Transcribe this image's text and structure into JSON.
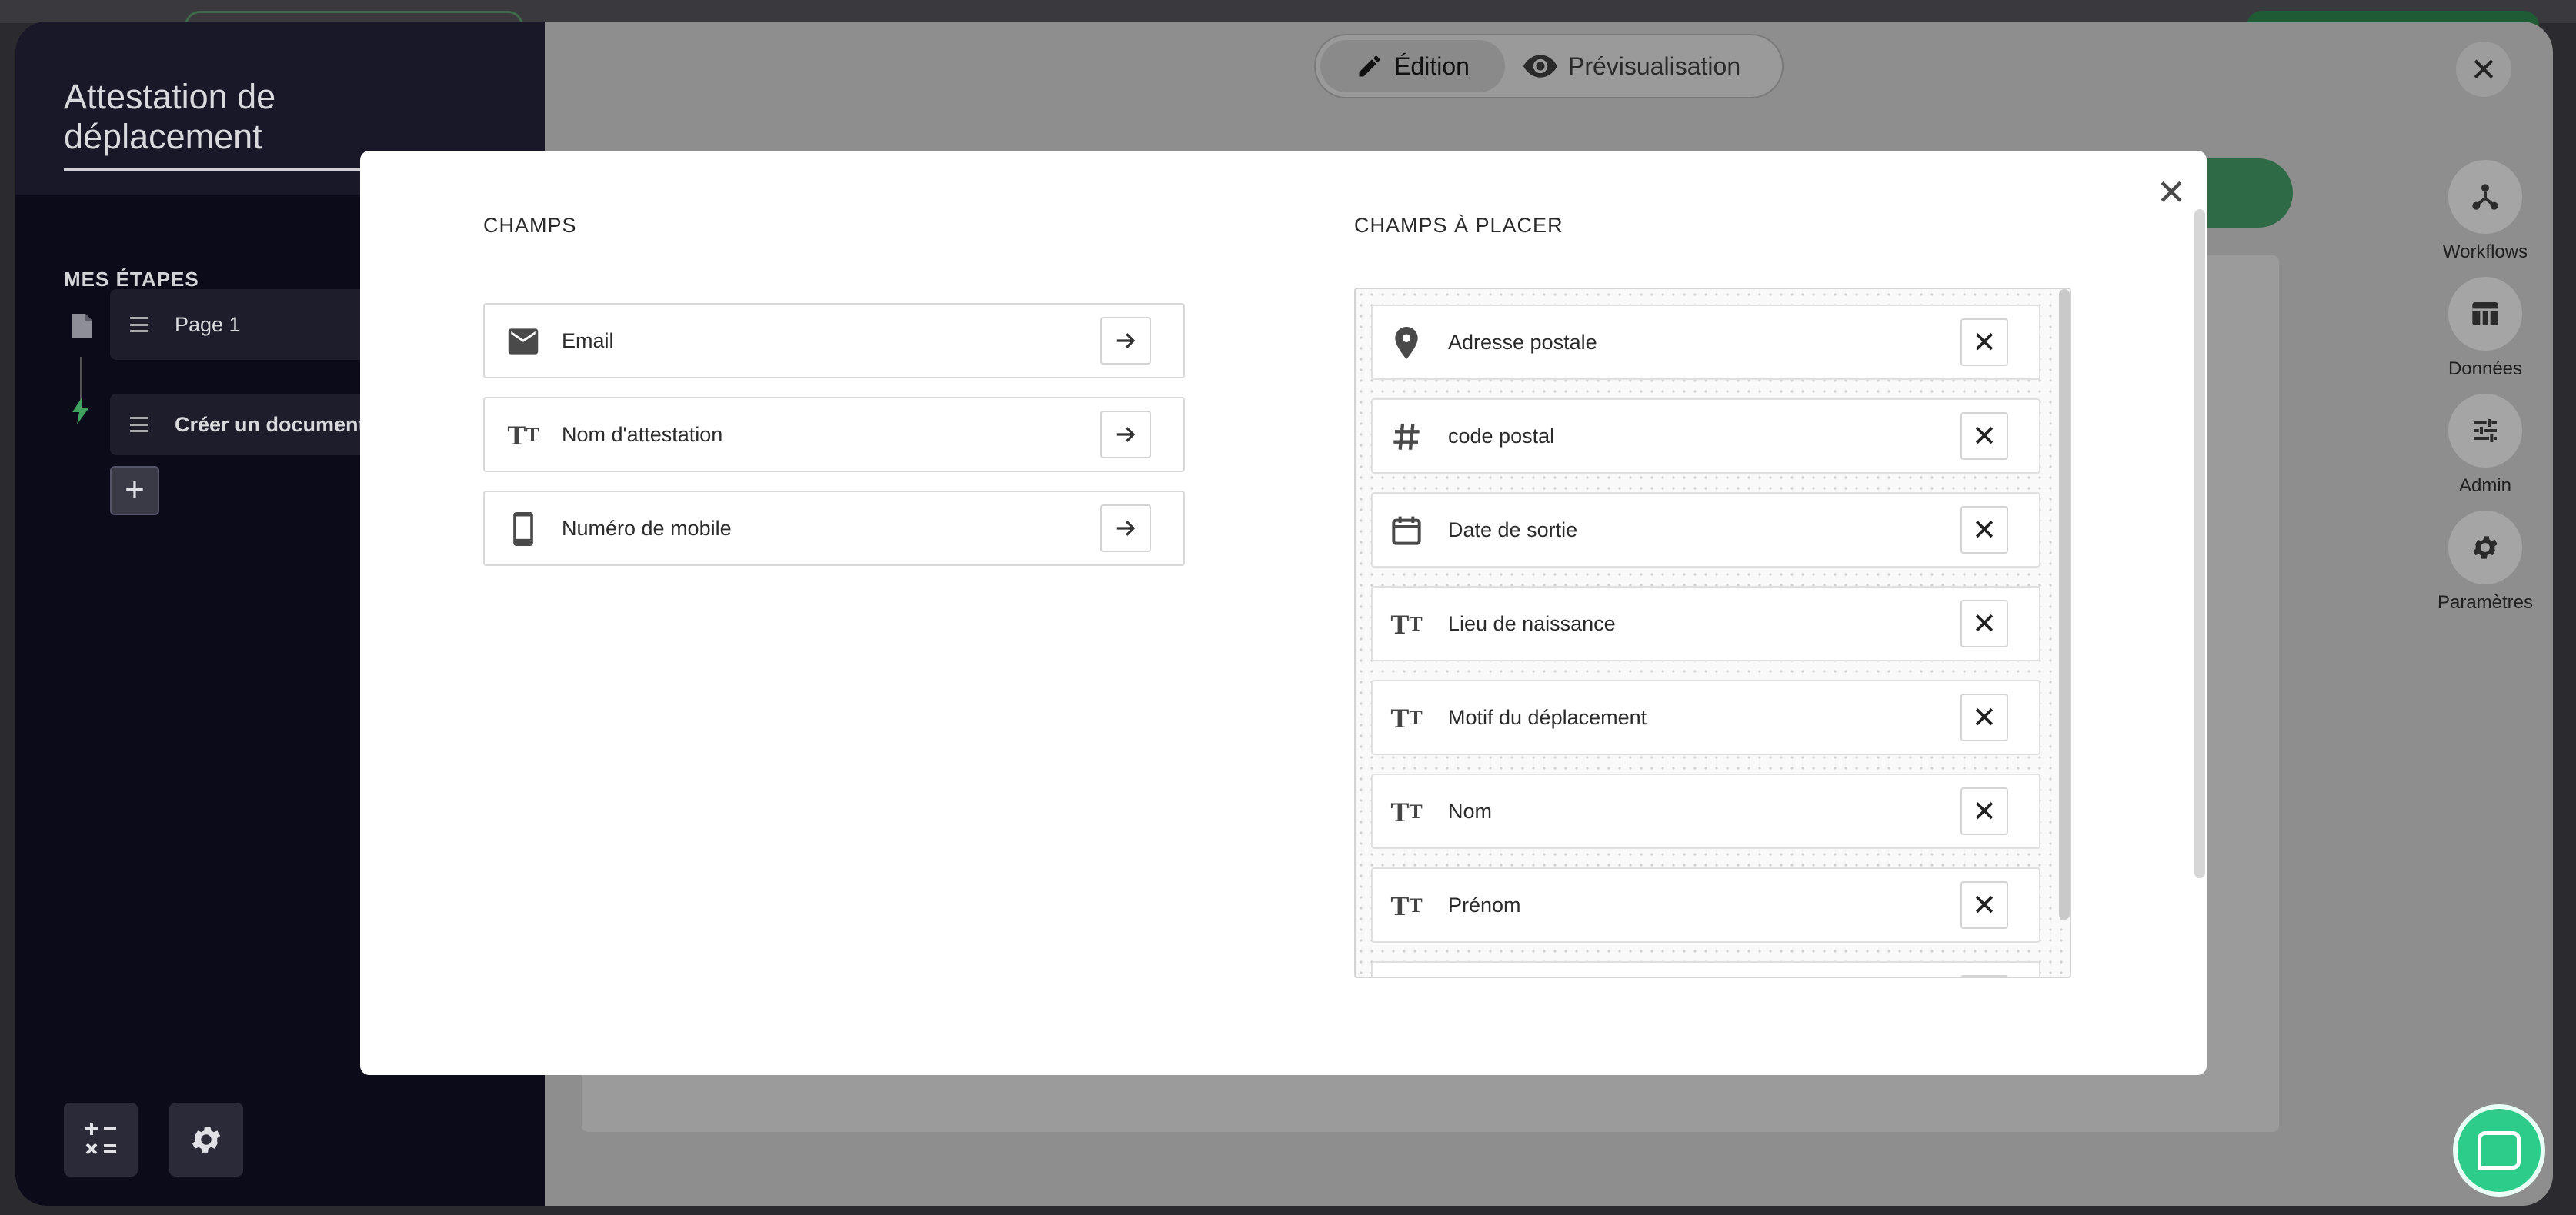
{
  "background": {
    "form_title": "Attestation de déplacement",
    "steps_label": "MES ÉTAPES",
    "steps": [
      {
        "label": "Page 1",
        "icon": "page-icon"
      },
      {
        "label": "Créer un document",
        "icon": "lightning-icon"
      }
    ],
    "add_step_symbol": "+",
    "tabs": {
      "edit": "Édition",
      "preview": "Prévisualisation"
    },
    "rail": [
      {
        "label": "Workflows",
        "icon": "workflow-icon"
      },
      {
        "label": "Données",
        "icon": "table-icon"
      },
      {
        "label": "Admin",
        "icon": "sliders-icon"
      },
      {
        "label": "Paramètres",
        "icon": "gear-icon"
      }
    ]
  },
  "modal": {
    "champs_title": "CHAMPS",
    "placer_title": "CHAMPS À PLACER",
    "champs": [
      {
        "label": "Email",
        "icon": "email-icon"
      },
      {
        "label": "Nom d'attestation",
        "icon": "text-icon"
      },
      {
        "label": "Numéro de mobile",
        "icon": "mobile-icon"
      }
    ],
    "a_placer": [
      {
        "label": "Adresse postale",
        "icon": "location-pin-icon"
      },
      {
        "label": "code postal",
        "icon": "hash-icon"
      },
      {
        "label": "Date de sortie",
        "icon": "calendar-icon"
      },
      {
        "label": "Lieu de naissance",
        "icon": "text-icon"
      },
      {
        "label": "Motif du déplacement",
        "icon": "text-icon"
      },
      {
        "label": "Nom",
        "icon": "text-icon"
      },
      {
        "label": "Prénom",
        "icon": "text-icon"
      }
    ]
  }
}
